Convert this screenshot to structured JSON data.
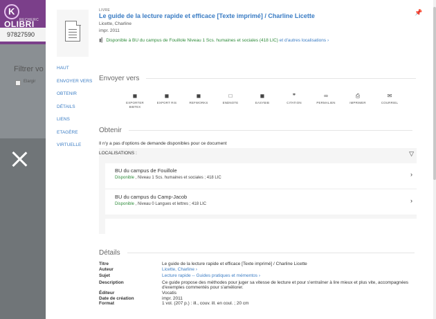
{
  "background": {
    "logo_letter": "K",
    "logo_text": "OLIBRI",
    "logo_sub": "RECHERC",
    "search_value": "97827590",
    "filter_label": "Filtrer vo",
    "checkbox_label": "Elargir"
  },
  "record": {
    "type": "LIVRE",
    "title": "Le guide de la lecture rapide et efficace [Texte imprimé] / Charline Licette",
    "author": "Licette, Charline",
    "date": "impr. 2011",
    "availability_icon": "▮▎",
    "availability_status": "Disponible",
    "availability_location": "à BU du campus de Fouillole  Niveau 1 Scs. humaines et sociales (418 LIC)",
    "availability_more": "et d'autres localisations ›"
  },
  "nav": [
    "HAUT",
    "ENVOYER VERS",
    "OBTENIR",
    "DÉTAILS",
    "LIENS",
    "ETAGÈRE",
    "VIRTUELLE"
  ],
  "send_to": {
    "heading": "Envoyer vers",
    "actions": [
      {
        "name": "export-bibtex",
        "icon": "◼",
        "label": "EXPORTER\nBIBTEX"
      },
      {
        "name": "export-ris",
        "icon": "◼",
        "label": "EXPORT RIS"
      },
      {
        "name": "refworks",
        "icon": "◼",
        "label": "REFWORKS"
      },
      {
        "name": "endnote",
        "icon": "□",
        "label": "ENDNOTE"
      },
      {
        "name": "easybib",
        "icon": "◼",
        "label": "EASYBIB"
      },
      {
        "name": "citation",
        "icon": "❞",
        "label": "CITATION"
      },
      {
        "name": "permalink",
        "icon": "∞",
        "label": "PERMALIEN"
      },
      {
        "name": "print",
        "icon": "⎙",
        "label": "IMPRIMER"
      },
      {
        "name": "email",
        "icon": "✉",
        "label": "COURRIEL"
      }
    ]
  },
  "obtain": {
    "heading": "Obtenir",
    "no_options": "Il n'y a pas d'options de demande disponibles pour ce document",
    "locations_label": "LOCALISATIONS :",
    "locations": [
      {
        "name": "BU du campus de Fouillole",
        "status": "Disponible",
        "detail": " , Niveau 1 Scs. humaines et sociales ; 418 LIC"
      },
      {
        "name": "BU du campus du Camp-Jacob",
        "status": "Disponible",
        "detail": " , Niveau 0 Langues et lettres ; 418 LIC"
      }
    ]
  },
  "details": {
    "heading": "Détails",
    "rows": [
      {
        "label": "Titre",
        "value": "Le guide de la lecture rapide et efficace [Texte imprimé] / Charline Licette",
        "link": false
      },
      {
        "label": "Auteur",
        "value": "Licette, Charline  ›",
        "link": true
      },
      {
        "label": "Sujet",
        "value": "Lecture rapide -- Guides pratiques et mémentos  ›",
        "link": true
      },
      {
        "label": "Description",
        "value": "Ce guide propose des méthodes pour juger sa vitesse de lecture et pour s'entraîner à lire mieux et plus vite, accompagnées d'exemples commentés pour s'améliorer.",
        "link": false
      },
      {
        "label": "Éditeur",
        "value": "Vocatis",
        "link": false
      },
      {
        "label": "Date de création",
        "value": "impr. 2011",
        "link": false
      },
      {
        "label": "Format",
        "value": "1 vol. (207 p.) : ill., couv. ill. en coul. ; 20 cm",
        "link": false
      }
    ]
  },
  "colors": {
    "link": "#3a7cc4",
    "available": "#2e8b3a",
    "header": "#7b3f8a"
  }
}
